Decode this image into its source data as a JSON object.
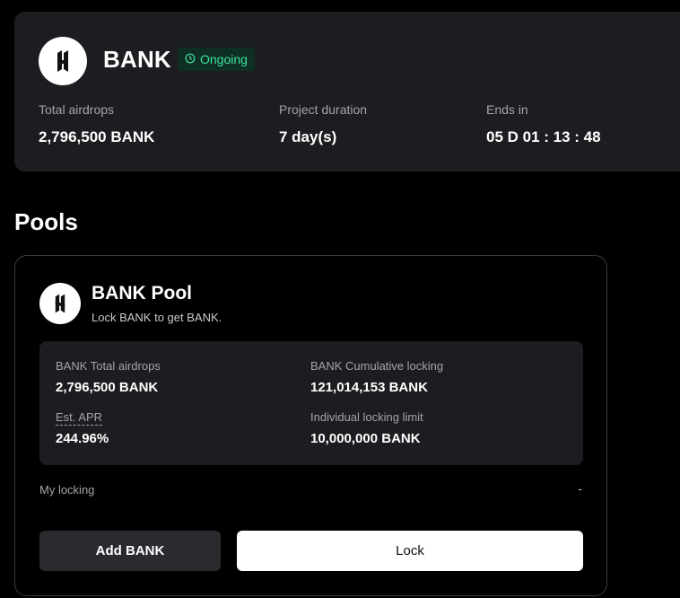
{
  "project": {
    "name": "BANK",
    "status": "Ongoing",
    "status_color": "#3ee6a0",
    "logo_icon": "bank-logo-icon",
    "stats": [
      {
        "label": "Total airdrops",
        "value": "2,796,500 BANK"
      },
      {
        "label": "Project duration",
        "value": "7 day(s)"
      },
      {
        "label": "Ends in",
        "value": "05 D 01 : 13 : 48"
      }
    ]
  },
  "pools_section": {
    "title": "Pools"
  },
  "pool": {
    "title": "BANK Pool",
    "subtitle": "Lock BANK to get BANK.",
    "stats": {
      "total_airdrops_label": "BANK Total airdrops",
      "total_airdrops_value": "2,796,500 BANK",
      "cumulative_locking_label": "BANK Cumulative locking",
      "cumulative_locking_value": "121,014,153 BANK",
      "apr_label": "Est. APR",
      "apr_value": "244.96%",
      "limit_label": "Individual locking limit",
      "limit_value": "10,000,000 BANK"
    },
    "my_locking_label": "My locking",
    "my_locking_value": "-",
    "add_button_label": "Add BANK",
    "lock_button_label": "Lock"
  }
}
